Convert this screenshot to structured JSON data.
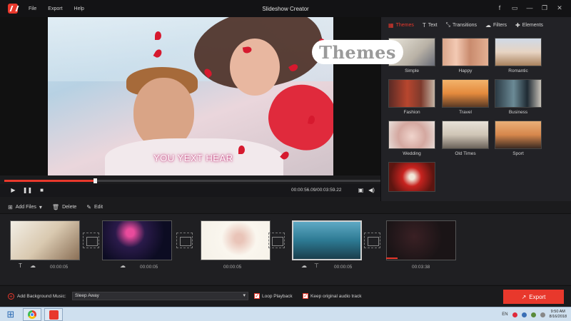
{
  "app": {
    "title": "Slideshow Creator",
    "menu": [
      "File",
      "Export",
      "Help"
    ],
    "window_icons": [
      "facebook-icon",
      "feedback-icon",
      "minimize-icon",
      "restore-icon",
      "close-icon"
    ]
  },
  "preview": {
    "caption": "YOU YEXT HEAR",
    "timecode": "00:00:56.09/00:03:59.22",
    "progress": 0.24
  },
  "panel": {
    "tabs": [
      {
        "label": "Themes",
        "icon": "themes-icon",
        "active": true
      },
      {
        "label": "Text",
        "icon": "text-icon",
        "active": false
      },
      {
        "label": "Transitions",
        "icon": "transitions-icon",
        "active": false
      },
      {
        "label": "Filters",
        "icon": "filters-icon",
        "active": false
      },
      {
        "label": "Elements",
        "icon": "elements-icon",
        "active": false
      }
    ],
    "overlay_text": "Themes",
    "themes": [
      {
        "label": "Simple"
      },
      {
        "label": "Happy"
      },
      {
        "label": "Romantic"
      },
      {
        "label": "Fashion"
      },
      {
        "label": "Travel"
      },
      {
        "label": "Business"
      },
      {
        "label": "Wedding"
      },
      {
        "label": "Old Times"
      },
      {
        "label": "Sport"
      },
      {
        "label": ""
      }
    ]
  },
  "toolbar": {
    "add_files": "Add Files",
    "delete": "Delete",
    "edit": "Edit"
  },
  "timeline": {
    "clips": [
      {
        "duration": "00:00:05"
      },
      {
        "duration": "00:00:05"
      },
      {
        "duration": "00:00:05"
      },
      {
        "duration": "00:00:05"
      },
      {
        "duration": "00:03:38"
      }
    ]
  },
  "bottom": {
    "bgm_label": "Add Background Music:",
    "bgm_value": "Sleep Away",
    "loop_label": "Loop Playback",
    "keep_audio_label": "Keep original audio track",
    "export_label": "Export"
  },
  "taskbar": {
    "lang": "EN",
    "time": "9:50 AM",
    "date": "8/16/2018"
  },
  "colors": {
    "accent": "#e8382c",
    "background": "#1b1b1d"
  }
}
